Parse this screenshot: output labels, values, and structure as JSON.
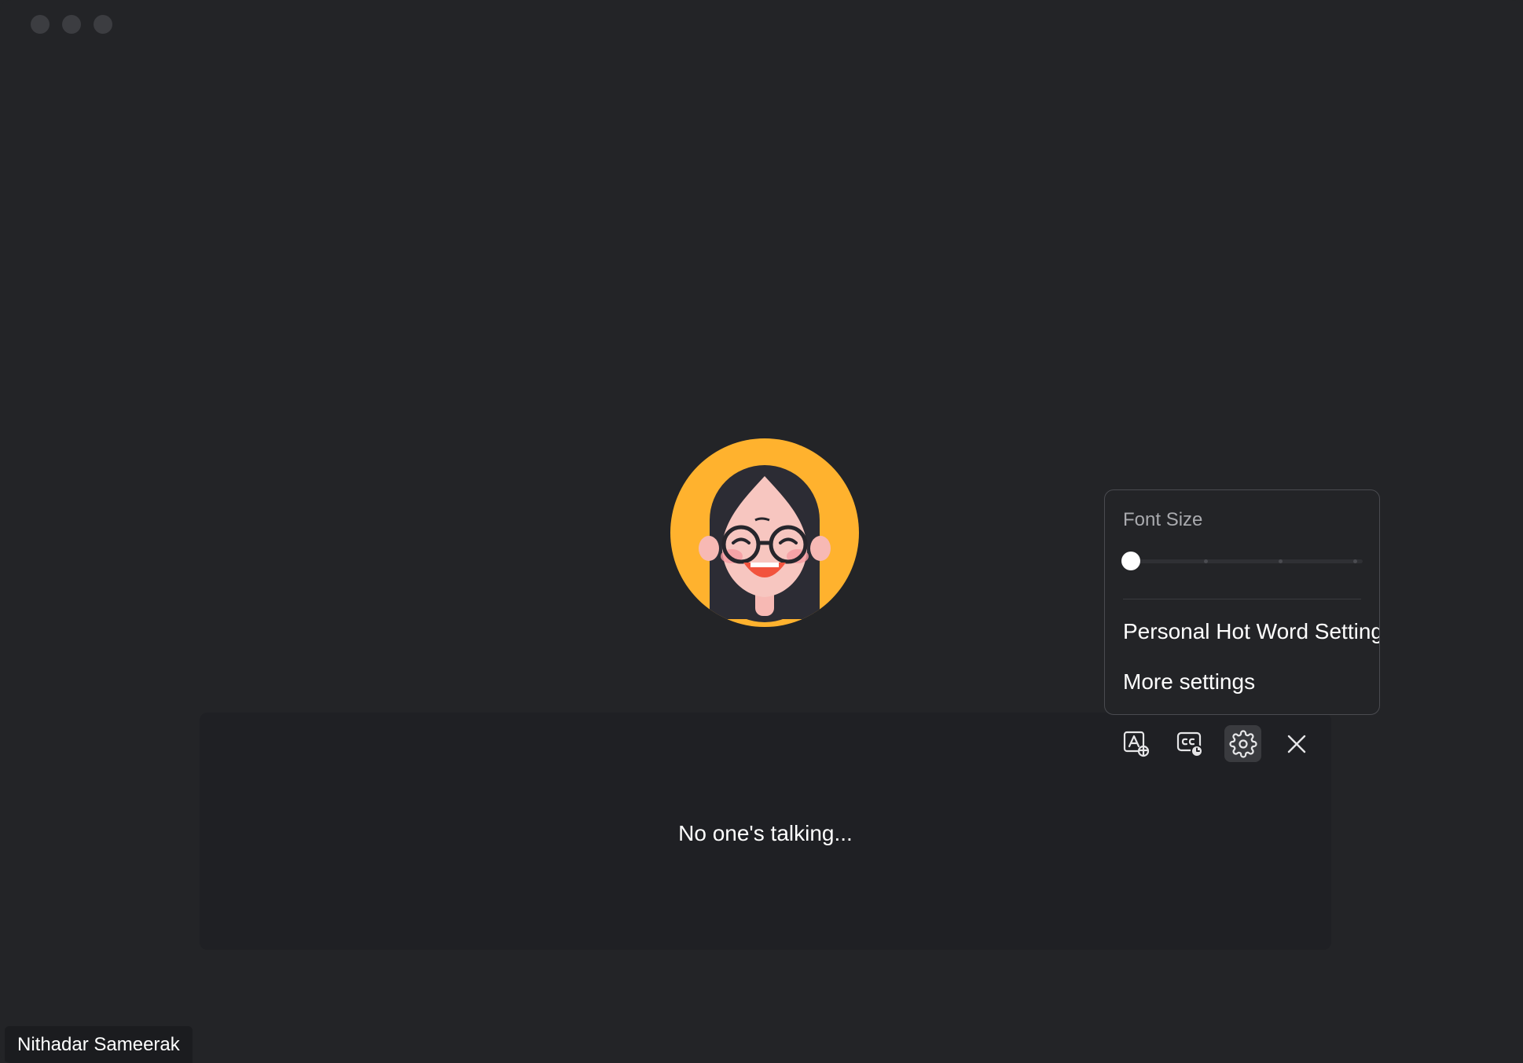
{
  "window": {
    "controls": [
      "close",
      "minimize",
      "zoom"
    ]
  },
  "participant": {
    "name": "Nithadar Sameerak",
    "avatar": "cartoon-avatar-girl-with-glasses"
  },
  "captions": {
    "status_text": "No one's talking..."
  },
  "toolbar": {
    "buttons": [
      {
        "icon": "translate-icon"
      },
      {
        "icon": "caption-history-icon"
      },
      {
        "icon": "gear-icon",
        "active": true
      },
      {
        "icon": "close-icon"
      }
    ]
  },
  "settings_menu": {
    "font_size_label": "Font Size",
    "font_size_level": 0,
    "font_size_steps": 4,
    "items": [
      {
        "label": "Personal Hot Word Settings"
      },
      {
        "label": "More settings"
      }
    ]
  },
  "colors": {
    "background": "#232427",
    "panel": "#1f2024",
    "avatar_ring": "#ffb22e"
  }
}
